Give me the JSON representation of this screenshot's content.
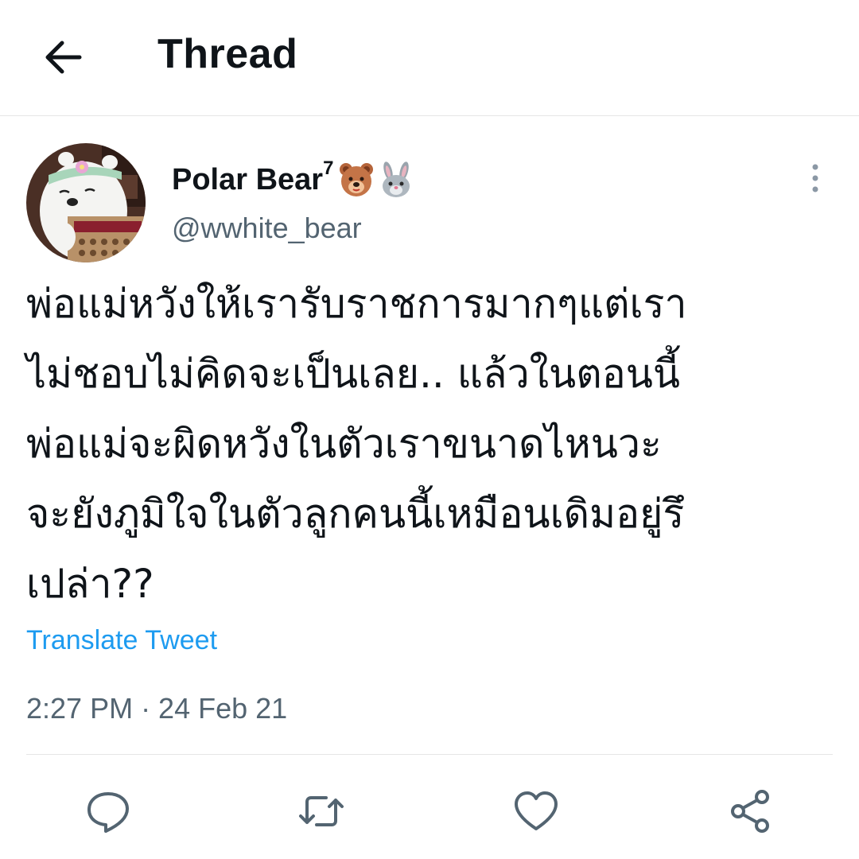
{
  "header": {
    "title": "Thread",
    "back_icon": "arrow-left-icon"
  },
  "tweet": {
    "display_name": "Polar Bear",
    "name_superscript": "7",
    "name_emojis": [
      "bear-face-emoji",
      "rabbit-face-emoji"
    ],
    "handle": "@wwhite_bear",
    "avatar": "polar-bear-cartoon-avatar",
    "text": "พ่อแม่หวังให้เรารับราชการมากๆแต่เรา\nไม่ชอบไม่คิดจะเป็นเลย.. แล้วในตอนนี้\nพ่อแม่จะผิดหวังในตัวเราขนาดไหนวะ\nจะยังภูมิใจในตัวลูกคนนี้เหมือนเดิมอยู่รึ\nเปล่า??",
    "translate_label": "Translate Tweet",
    "timestamp": "2:27 PM · 24 Feb 21"
  },
  "actions": [
    {
      "icon": "reply-icon"
    },
    {
      "icon": "retweet-icon"
    },
    {
      "icon": "like-icon"
    },
    {
      "icon": "share-icon"
    }
  ],
  "colors": {
    "link": "#1d9bf0",
    "secondary_text": "#536471",
    "icon": "#536471",
    "divider": "#e6e6e6"
  }
}
